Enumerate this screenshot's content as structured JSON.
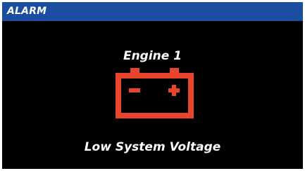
{
  "header": {
    "title": "ALARM",
    "bar_color": "#1b4da0"
  },
  "alarm": {
    "source": "Engine 1",
    "icon": "battery-icon",
    "icon_color": "#e8452c",
    "message": "Low System Voltage"
  }
}
